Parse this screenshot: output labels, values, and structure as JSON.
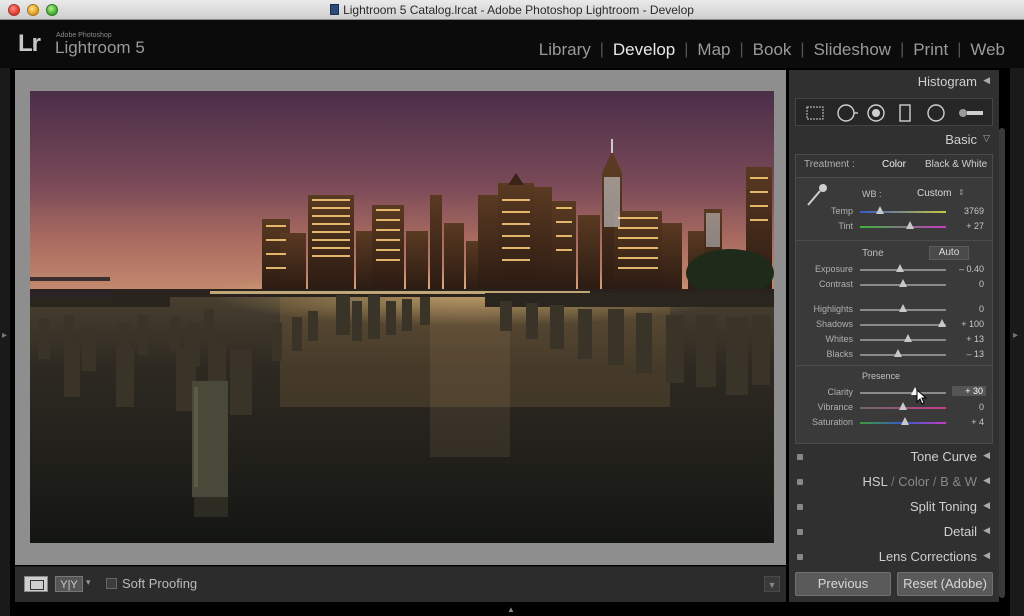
{
  "window": {
    "title": "Lightroom 5 Catalog.lrcat - Adobe Photoshop Lightroom - Develop"
  },
  "brand": {
    "logo": "Lr",
    "vendor": "Adobe Photoshop",
    "product": "Lightroom 5"
  },
  "modules": [
    {
      "label": "Library"
    },
    {
      "label": "Develop"
    },
    {
      "label": "Map"
    },
    {
      "label": "Book"
    },
    {
      "label": "Slideshow"
    },
    {
      "label": "Print"
    },
    {
      "label": "Web"
    }
  ],
  "toolbar": {
    "yy_label": "Y|Y",
    "soft_proofing": "Soft Proofing"
  },
  "panels": {
    "histogram": "Histogram",
    "basic": "Basic",
    "tone_curve": "Tone Curve",
    "hsl": {
      "a": "HSL",
      "b": "Color",
      "c": "B & W",
      "slash": "/"
    },
    "split_toning": "Split Toning",
    "detail": "Detail",
    "lens_corrections": "Lens Corrections"
  },
  "basic": {
    "treatment_label": "Treatment :",
    "treatment_color": "Color",
    "treatment_bw": "Black & White",
    "wb_label": "WB :",
    "wb_value": "Custom",
    "tone_label": "Tone",
    "auto_label": "Auto",
    "presence_label": "Presence",
    "sliders": {
      "temp": {
        "label": "Temp",
        "value": "3769"
      },
      "tint": {
        "label": "Tint",
        "value": "+ 27"
      },
      "exposure": {
        "label": "Exposure",
        "value": "– 0.40"
      },
      "contrast": {
        "label": "Contrast",
        "value": "0"
      },
      "highlights": {
        "label": "Highlights",
        "value": "0"
      },
      "shadows": {
        "label": "Shadows",
        "value": "+ 100"
      },
      "whites": {
        "label": "Whites",
        "value": "+ 13"
      },
      "blacks": {
        "label": "Blacks",
        "value": "– 13"
      },
      "clarity": {
        "label": "Clarity",
        "value": "+ 30"
      },
      "vibrance": {
        "label": "Vibrance",
        "value": "0"
      },
      "saturation": {
        "label": "Saturation",
        "value": "+ 4"
      }
    }
  },
  "buttons": {
    "previous": "Previous",
    "reset": "Reset (Adobe)"
  }
}
